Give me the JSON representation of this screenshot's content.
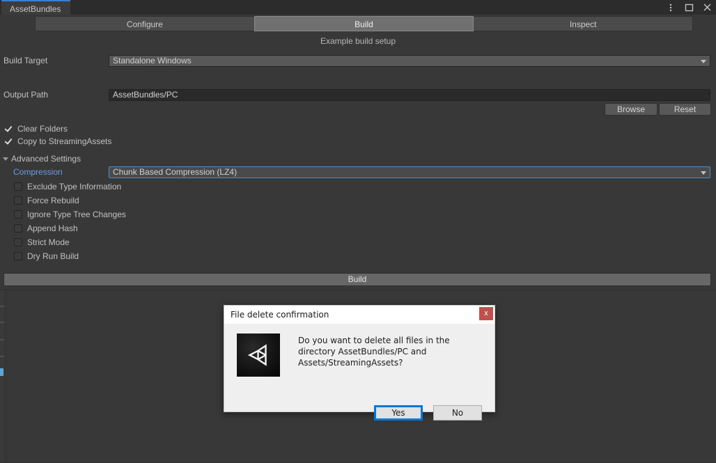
{
  "window": {
    "tab_label": "AssetBundles",
    "chrome": {
      "menu_icon": "kebab-menu-icon",
      "maximize_icon": "maximize-icon",
      "close_icon": "close-icon"
    }
  },
  "mode_tabs": [
    {
      "label": "Configure",
      "selected": false
    },
    {
      "label": "Build",
      "selected": true
    },
    {
      "label": "Inspect",
      "selected": false
    }
  ],
  "caption": "Example build setup",
  "fields": {
    "build_target": {
      "label": "Build Target",
      "value": "Standalone Windows"
    },
    "output_path": {
      "label": "Output Path",
      "value": "AssetBundles/PC"
    },
    "compression": {
      "label": "Compression",
      "value": "Chunk Based Compression (LZ4)"
    }
  },
  "buttons": {
    "browse": "Browse",
    "reset": "Reset",
    "build": "Build"
  },
  "top_toggles": [
    {
      "label": "Clear Folders",
      "checked": true
    },
    {
      "label": "Copy to StreamingAssets",
      "checked": true
    }
  ],
  "advanced": {
    "foldout_label": "Advanced Settings",
    "expanded": true,
    "toggles": [
      {
        "label": "Exclude Type Information",
        "checked": false
      },
      {
        "label": "Force Rebuild",
        "checked": false
      },
      {
        "label": "Ignore Type Tree Changes",
        "checked": false
      },
      {
        "label": "Append Hash",
        "checked": false
      },
      {
        "label": "Strict Mode",
        "checked": false
      },
      {
        "label": "Dry Run Build",
        "checked": false
      }
    ]
  },
  "dialog": {
    "title": "File delete confirmation",
    "close_label": "x",
    "message": "Do you want to delete all files in the directory AssetBundles/PC and Assets/StreamingAssets?",
    "yes_label": "Yes",
    "no_label": "No",
    "logo_icon": "unity-logo-icon"
  },
  "colors": {
    "panel_bg": "#383838",
    "tab_accent": "#3b7fd4",
    "field_focus": "#4a8ed0",
    "label_accent": "#6a9ee8",
    "dialog_close_bg": "#c0504d",
    "dialog_focus": "#0078d7"
  }
}
